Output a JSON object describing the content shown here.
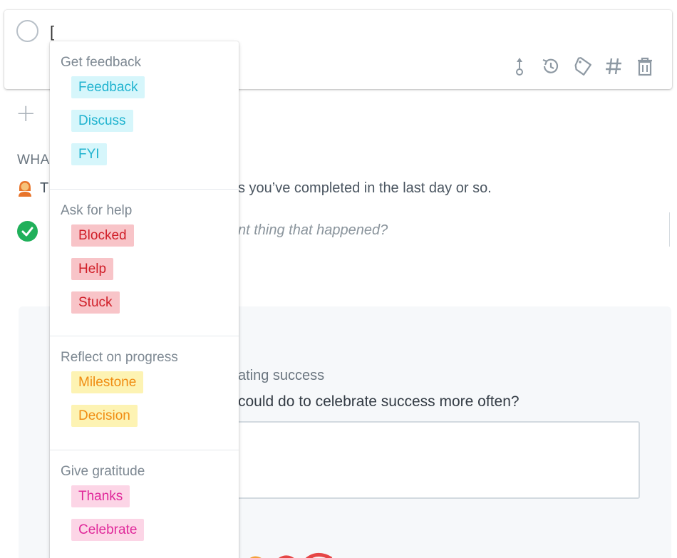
{
  "task": {
    "input_value": "[",
    "toolbar": [
      {
        "name": "move-up-icon"
      },
      {
        "name": "history-icon"
      },
      {
        "name": "tag-icon"
      },
      {
        "name": "hash-icon"
      },
      {
        "name": "trash-icon"
      }
    ]
  },
  "background": {
    "add_symbol": "+",
    "section_label": "WHA",
    "hint_prefix": "T",
    "hint_text": "s you’ve completed in the last day or so.",
    "win_placeholder": "nt thing that happened?",
    "reflect_heading": "ating success",
    "reflect_question": "could do to celebrate success more often?"
  },
  "dropdown": {
    "groups": [
      {
        "title": "Get feedback",
        "tags": [
          "Feedback",
          "Discuss",
          "FYI"
        ]
      },
      {
        "title": "Ask for help",
        "tags": [
          "Blocked",
          "Help",
          "Stuck"
        ]
      },
      {
        "title": "Reflect on progress",
        "tags": [
          "Milestone",
          "Decision"
        ]
      },
      {
        "title": "Give gratitude",
        "tags": [
          "Thanks",
          "Celebrate"
        ]
      }
    ]
  },
  "colors": {
    "feedback_bg": "#d6f6fb",
    "feedback_text": "#1fb3cf",
    "help_bg": "#f8c4c8",
    "help_text": "#d01e28",
    "progress_bg": "#fdf3b3",
    "progress_text": "#f08c12",
    "gratitude_bg": "#fcd5e6",
    "gratitude_text": "#e0289a",
    "done_green": "#20b05a"
  }
}
